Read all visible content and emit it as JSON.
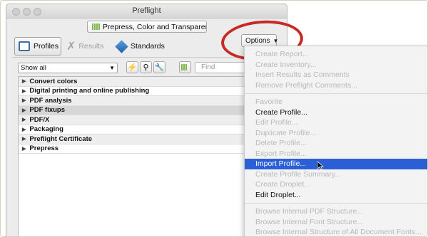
{
  "window": {
    "title": "Preflight",
    "profile_selector": "Prepress, Color and Transparency",
    "tabs": [
      {
        "label": "Profiles"
      },
      {
        "label": "Results"
      },
      {
        "label": "Standards"
      }
    ],
    "filter_value": "Show all",
    "find_placeholder": "Find",
    "profile_categories": [
      "Convert colors",
      "Digital printing and online publishing",
      "PDF analysis",
      "PDF fixups",
      "PDF/X",
      "Packaging",
      "Preflight Certificate",
      "Prepress"
    ]
  },
  "options": {
    "label": "Options",
    "groups": [
      [
        {
          "label": "Create Report...",
          "enabled": false
        },
        {
          "label": "Create Inventory...",
          "enabled": false
        },
        {
          "label": "Insert Results as Comments",
          "enabled": false
        },
        {
          "label": "Remove Preflight Comments...",
          "enabled": false
        }
      ],
      [
        {
          "label": "Favorite",
          "enabled": false
        },
        {
          "label": "Create Profile...",
          "enabled": true
        },
        {
          "label": "Edit Profile...",
          "enabled": false
        },
        {
          "label": "Duplicate Profile...",
          "enabled": false
        },
        {
          "label": "Delete Profile...",
          "enabled": false
        },
        {
          "label": "Export Profile...",
          "enabled": false
        },
        {
          "label": "Import Profile...",
          "enabled": true,
          "highlighted": true
        },
        {
          "label": "Create Profile Summary...",
          "enabled": false
        },
        {
          "label": "Create Droplet...",
          "enabled": false
        },
        {
          "label": "Edit Droplet...",
          "enabled": true
        }
      ],
      [
        {
          "label": "Browse Internal PDF Structure...",
          "enabled": false
        },
        {
          "label": "Browse Internal Font Structure...",
          "enabled": false
        },
        {
          "label": "Browse Internal Structure of All Document Fonts...",
          "enabled": false
        }
      ]
    ]
  },
  "colors": {
    "highlight": "#2a5fd6",
    "annotation_ring": "#c72a25",
    "accent_green": "#7ab648"
  }
}
